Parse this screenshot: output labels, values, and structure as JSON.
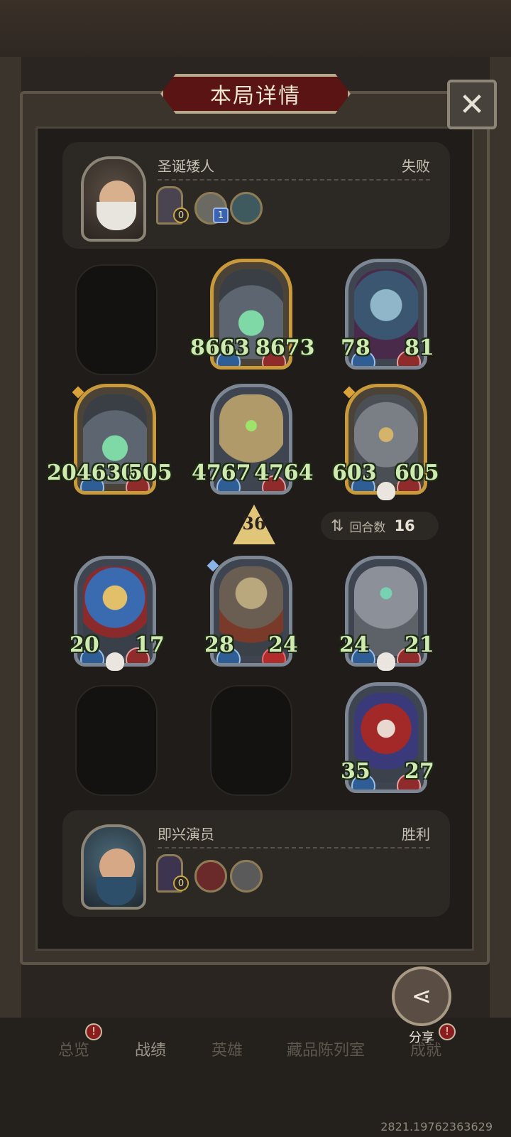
{
  "title": "本局详情",
  "close_icon": "close-icon",
  "opponent": {
    "name": "圣诞矮人",
    "result": "失败",
    "item_badges": [
      "0",
      "1"
    ]
  },
  "player": {
    "name": "即兴演员",
    "result": "胜利",
    "item_badges": [
      "0"
    ]
  },
  "enemy_board": [
    {
      "attack": "8663",
      "health": "8673",
      "frame": "gold"
    },
    {
      "attack": "78",
      "health": "81",
      "frame": "silver"
    },
    {
      "attack": "204630",
      "health": "505",
      "frame": "gold"
    },
    {
      "attack": "4767",
      "health": "4764",
      "frame": "silver"
    },
    {
      "attack": "603",
      "health": "605",
      "frame": "gold"
    }
  ],
  "player_board": [
    {
      "attack": "20",
      "health": "17",
      "frame": "silver"
    },
    {
      "attack": "28",
      "health": "24",
      "frame": "silver"
    },
    {
      "attack": "24",
      "health": "21",
      "frame": "silver"
    },
    {
      "attack": "35",
      "health": "27",
      "frame": "silver"
    }
  ],
  "turn_indicator": "36",
  "rounds": {
    "label": "回合数",
    "value": "16"
  },
  "share_label": "分享",
  "tabs": [
    {
      "label": "总览",
      "active": false
    },
    {
      "label": "战绩",
      "active": true
    },
    {
      "label": "英雄",
      "active": false
    },
    {
      "label": "藏品陈列室",
      "active": false
    },
    {
      "label": "成就",
      "active": false
    }
  ],
  "tab_alert": "!",
  "footer_id": "2821.19762363629",
  "colors": {
    "title_bg": "#5a1414",
    "stat_text": "#cfeab0",
    "gold_frame": "#c99a3a",
    "silver_frame": "#7d8693"
  }
}
